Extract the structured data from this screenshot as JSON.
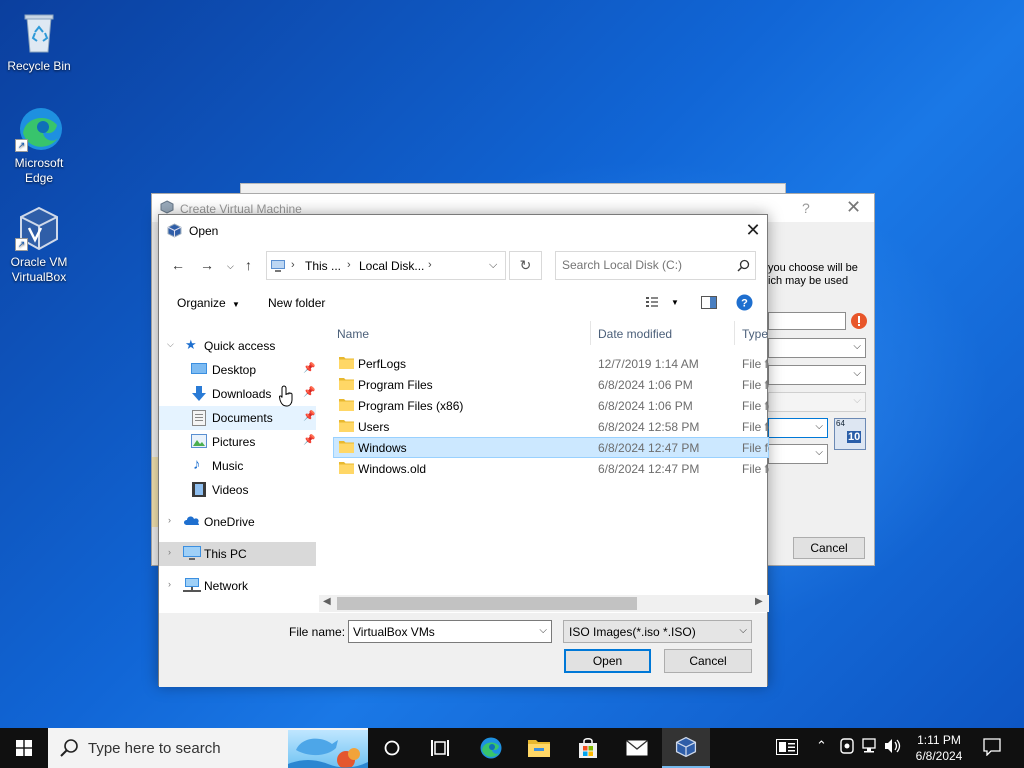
{
  "desktop": {
    "icons": [
      {
        "label": "Recycle Bin"
      },
      {
        "label_line1": "Microsoft",
        "label_line2": "Edge"
      },
      {
        "label_line1": "Oracle VM",
        "label_line2": "VirtualBox"
      }
    ]
  },
  "create_vm": {
    "title": "Create Virtual Machine",
    "help": "?",
    "close": "✕",
    "text_line1": "you choose will be",
    "text_line2": "ich may be used",
    "cancel_label": "Cancel"
  },
  "open_dialog": {
    "title": "Open",
    "close": "✕",
    "address": {
      "crumbs": [
        "This ...",
        "Local Disk..."
      ]
    },
    "search_placeholder": "Search Local Disk (C:)",
    "toolbar": {
      "organize": "Organize",
      "new_folder": "New folder"
    },
    "nav": {
      "quick_access": "Quick access",
      "items": [
        "Desktop",
        "Downloads",
        "Documents",
        "Pictures",
        "Music",
        "Videos"
      ],
      "onedrive": "OneDrive",
      "this_pc": "This PC",
      "network": "Network"
    },
    "columns": {
      "name": "Name",
      "date": "Date modified",
      "type": "Type"
    },
    "files": [
      {
        "name": "PerfLogs",
        "date": "12/7/2019 1:14 AM",
        "type": "File fo"
      },
      {
        "name": "Program Files",
        "date": "6/8/2024 1:06 PM",
        "type": "File fo"
      },
      {
        "name": "Program Files (x86)",
        "date": "6/8/2024 1:06 PM",
        "type": "File fo"
      },
      {
        "name": "Users",
        "date": "6/8/2024 12:58 PM",
        "type": "File fo"
      },
      {
        "name": "Windows",
        "date": "6/8/2024 12:47 PM",
        "type": "File fo"
      },
      {
        "name": "Windows.old",
        "date": "6/8/2024 12:47 PM",
        "type": "File fo"
      }
    ],
    "selected_file": "Windows",
    "file_name_label": "File name:",
    "file_name_value": "VirtualBox VMs",
    "filter_value": "ISO Images(*.iso *.ISO)",
    "open_label": "Open",
    "cancel_label": "Cancel"
  },
  "taskbar": {
    "search_placeholder": "Type here to search",
    "time": "1:11 PM",
    "date": "6/8/2024"
  },
  "colors": {
    "accent": "#0078d7",
    "selection": "#cce8ff",
    "folder": "#ffd766"
  }
}
